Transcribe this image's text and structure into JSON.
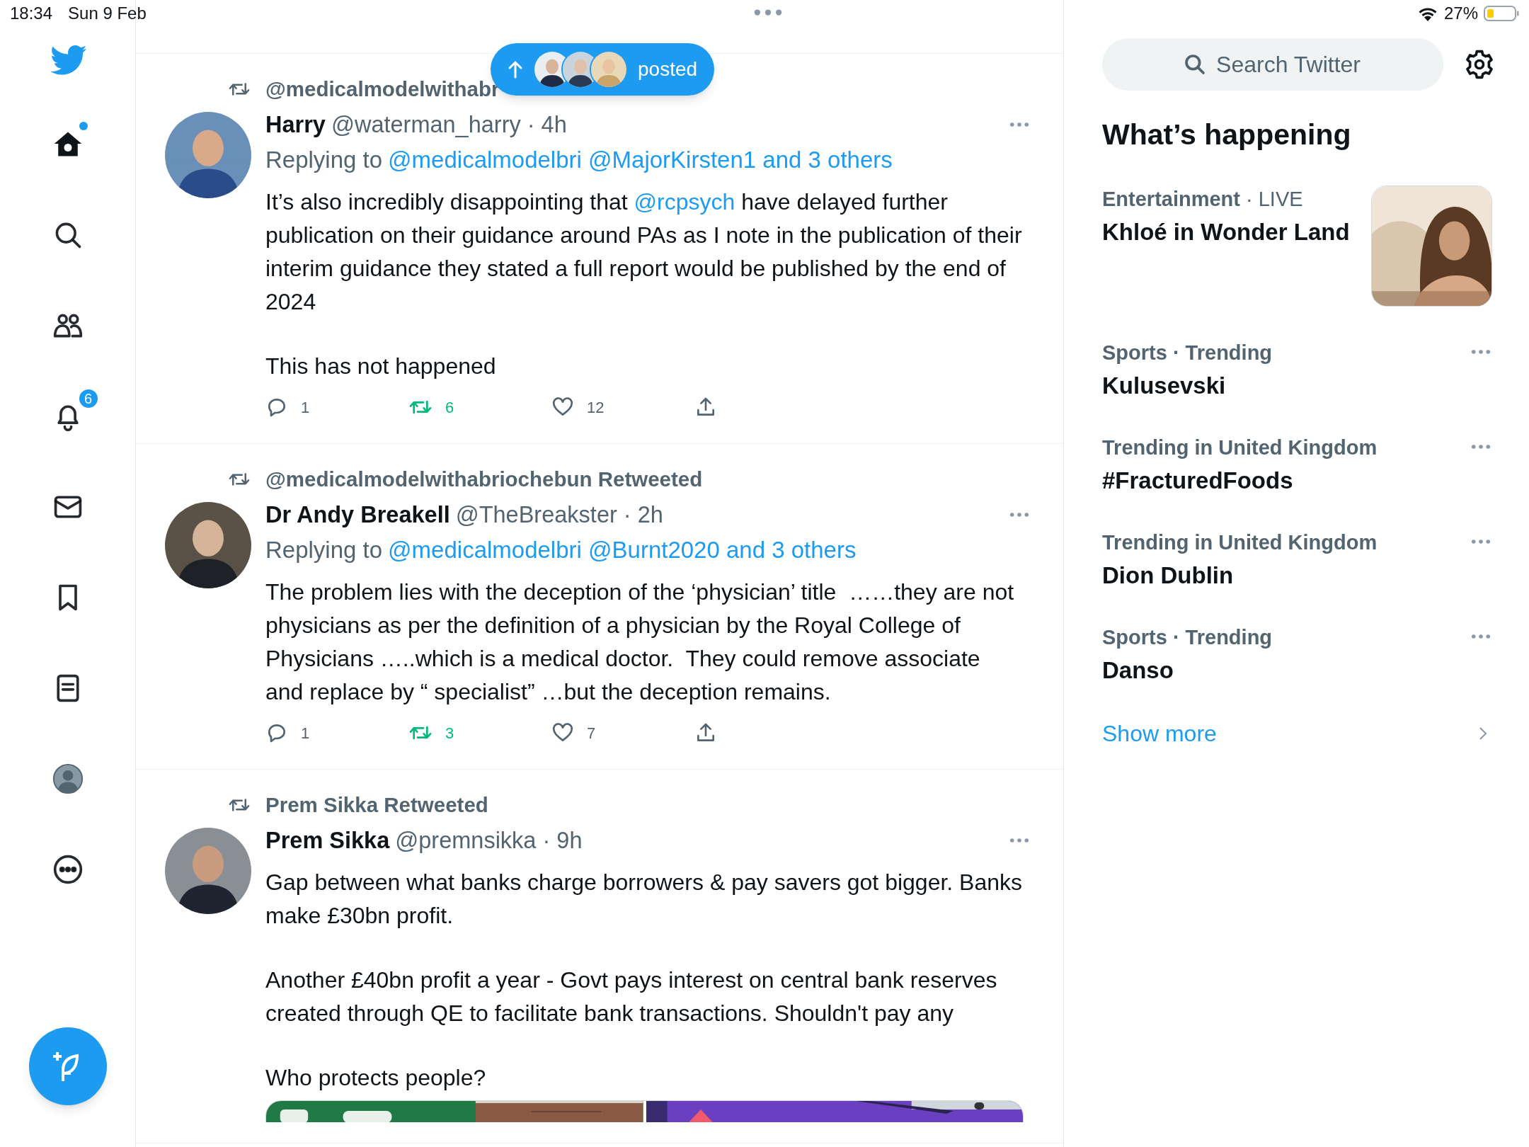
{
  "status_bar": {
    "time": "18:34",
    "date": "Sun 9 Feb",
    "battery": "27%"
  },
  "nav": [
    {
      "kind": "home",
      "selected": true,
      "unread_dot": true
    },
    {
      "kind": "search",
      "selected": false,
      "unread_dot": false
    },
    {
      "kind": "communities",
      "selected": false,
      "unread_dot": false
    },
    {
      "kind": "notifications",
      "selected": false,
      "unread_dot": false,
      "badge": "6"
    },
    {
      "kind": "messages",
      "selected": false,
      "unread_dot": false
    },
    {
      "kind": "bookmarks",
      "selected": false,
      "unread_dot": false
    },
    {
      "kind": "lists",
      "selected": false,
      "unread_dot": false
    },
    {
      "kind": "profile",
      "selected": false,
      "unread_dot": false
    },
    {
      "kind": "more",
      "selected": false,
      "unread_dot": false
    }
  ],
  "new_posts": {
    "label": "posted",
    "avatars": [
      {
        "kind": "picture"
      },
      {
        "kind": "picture"
      },
      {
        "kind": "picture"
      }
    ]
  },
  "tweets": [
    {
      "retweeted_by": "@medicalmodelwithabr",
      "avatar": {
        "kind": "picture"
      },
      "name": "Harry",
      "handle_time": "@waterman_harry · 4h",
      "reply_prefix": "Replying to",
      "reply_to": "@medicalmodelbri @MajorKirsten1 and 3 others",
      "paragraphs": [
        [
          {
            "kind": "text",
            "text": "It’s also incredibly disappointing that "
          },
          {
            "kind": "mention",
            "text": "@rcpsych"
          },
          {
            "kind": "text",
            "text": " have delayed further publication on their guidance around PAs as I note in the publication of their interim guidance they stated a full report would be published by the end of 2024"
          }
        ],
        [
          {
            "kind": "text",
            "text": "This has not happened"
          }
        ]
      ],
      "actions": {
        "replies": "1",
        "retweets": "6",
        "likes": "12",
        "retweeted": true,
        "liked": false
      }
    },
    {
      "retweeted_by": "@medicalmodelwithabriochebun Retweeted",
      "avatar": {
        "kind": "picture"
      },
      "name": "Dr Andy Breakell",
      "handle_time": "@TheBreakster · 2h",
      "reply_prefix": "Replying to",
      "reply_to": "@medicalmodelbri @Burnt2020 and 3 others",
      "paragraphs": [
        [
          {
            "kind": "text",
            "text": "The problem lies with the deception of the ‘physician’ title  ……they are not physicians as per the definition of a physician by the Royal College of Physicians …..which is a medical doctor.  They could remove associate and replace by “ specialist” …but the deception remains."
          }
        ]
      ],
      "actions": {
        "replies": "1",
        "retweets": "3",
        "likes": "7",
        "retweeted": true,
        "liked": false
      }
    },
    {
      "retweeted_by": "Prem Sikka Retweeted",
      "avatar": {
        "kind": "picture"
      },
      "name": "Prem Sikka",
      "handle_time": "@premnsikka · 9h",
      "paragraphs": [
        [
          {
            "kind": "text",
            "text": "Gap between what banks charge borrowers & pay savers got bigger. Banks make £30bn profit."
          }
        ],
        [
          {
            "kind": "text",
            "text": "Another £40bn profit a year - Govt pays interest on central bank reserves created through QE to facilitate bank transactions. Shouldn't pay any"
          }
        ],
        [
          {
            "kind": "text",
            "text": "Who protects people?"
          }
        ]
      ],
      "media": [
        {
          "kind": "picture"
        },
        {
          "kind": "picture"
        }
      ]
    }
  ],
  "search": {
    "placeholder": "Search Twitter"
  },
  "trends_title": "What’s happening",
  "trends": [
    {
      "category": "Entertainment",
      "label": "· LIVE",
      "title": "Khloé in Wonder Land",
      "image": {
        "kind": "picture"
      }
    },
    {
      "category": "Sports · Trending",
      "title": "Kulusevski"
    },
    {
      "category": "Trending in United Kingdom",
      "title": "#FracturedFoods"
    },
    {
      "category": "Trending in United Kingdom",
      "title": "Dion Dublin"
    },
    {
      "category": "Sports · Trending",
      "title": "Danso"
    }
  ],
  "show_more": "Show more"
}
